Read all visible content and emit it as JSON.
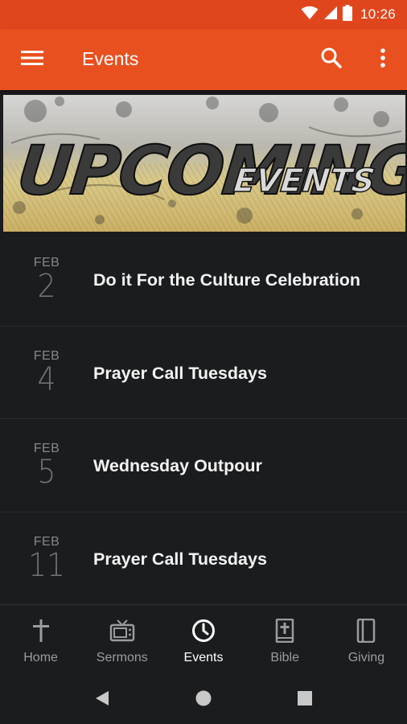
{
  "status_bar": {
    "time": "10:26"
  },
  "app_bar": {
    "title": "Events",
    "menu_icon": "hamburger-menu-icon",
    "search_icon": "search-icon",
    "more_icon": "more-vert-icon"
  },
  "banner": {
    "text_main": "UPCOMING",
    "text_sub": "EVENTS"
  },
  "events": [
    {
      "month": "FEB",
      "day": "2",
      "title": "Do it For the Culture Celebration"
    },
    {
      "month": "FEB",
      "day": "4",
      "title": "Prayer Call Tuesdays"
    },
    {
      "month": "FEB",
      "day": "5",
      "title": "Wednesday Outpour"
    },
    {
      "month": "FEB",
      "day": "11",
      "title": "Prayer Call Tuesdays"
    }
  ],
  "bottom_nav": [
    {
      "label": "Home",
      "icon": "cross-icon",
      "active": false
    },
    {
      "label": "Sermons",
      "icon": "tv-icon",
      "active": false
    },
    {
      "label": "Events",
      "icon": "clock-icon",
      "active": true
    },
    {
      "label": "Bible",
      "icon": "bible-icon",
      "active": false
    },
    {
      "label": "Giving",
      "icon": "giving-icon",
      "active": false
    }
  ],
  "colors": {
    "app_bar": "#e8501f",
    "status_bar": "#e0461e",
    "background": "#1b1c1e"
  }
}
